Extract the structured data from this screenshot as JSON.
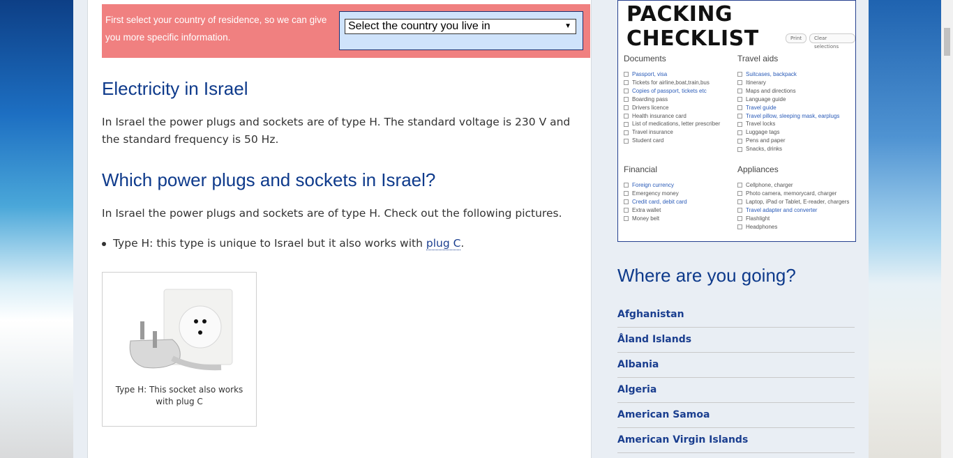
{
  "notice": {
    "text": "First select your country of residence, so we can give you more specific information.",
    "select_value": "Select the country you live in"
  },
  "main": {
    "h_electricity": "Electricity in Israel",
    "p_electricity": "In Israel the power plugs and sockets are of type H. The standard voltage is 230 V and the standard frequency is 50 Hz.",
    "h_which": "Which power plugs and sockets in Israel?",
    "p_which": "In Israel the power plugs and sockets are of type H. Check out the following pictures.",
    "bullet_text": "Type H: this type is unique to Israel but it also works with ",
    "bullet_link": "plug C",
    "bullet_end": ".",
    "figure_caption": "Type H: This socket also works with plug C"
  },
  "checklist": {
    "title": "PACKING CHECKLIST",
    "print": "Print",
    "clear": "Clear selections",
    "documents": {
      "heading": "Documents",
      "items": [
        {
          "label": "Passport, visa",
          "link": true
        },
        {
          "label": "Tickets for airline,boat,train,bus",
          "link": false
        },
        {
          "label": "Copies of passport, tickets etc",
          "link": true
        },
        {
          "label": "Boarding pass",
          "link": false
        },
        {
          "label": "Drivers licence",
          "link": false
        },
        {
          "label": "Health insurance card",
          "link": false
        },
        {
          "label": "List of medications, letter prescriber",
          "link": false
        },
        {
          "label": "Travel insurance",
          "link": false
        },
        {
          "label": "Student card",
          "link": false
        }
      ]
    },
    "travel_aids": {
      "heading": "Travel aids",
      "items": [
        {
          "label": "Suitcases, backpack",
          "link": true
        },
        {
          "label": "Itinerary",
          "link": false
        },
        {
          "label": "Maps and directions",
          "link": false
        },
        {
          "label": "Language guide",
          "link": false
        },
        {
          "label": "Travel guide",
          "link": true
        },
        {
          "label": "Travel pillow, sleeping mask, earplugs",
          "link": true
        },
        {
          "label": "Travel locks",
          "link": false
        },
        {
          "label": "Luggage tags",
          "link": false
        },
        {
          "label": "Pens and paper",
          "link": false
        },
        {
          "label": "Snacks, drinks",
          "link": false
        }
      ]
    },
    "financial": {
      "heading": "Financial",
      "items": [
        {
          "label": "Foreign currency",
          "link": true
        },
        {
          "label": "Emergency money",
          "link": false
        },
        {
          "label": "Credit card, debit card",
          "link": true
        },
        {
          "label": "Extra wallet",
          "link": false
        },
        {
          "label": "Money belt",
          "link": false
        }
      ]
    },
    "appliances": {
      "heading": "Appliances",
      "items": [
        {
          "label": "Cellphone, charger",
          "link": false
        },
        {
          "label": "Photo camera, memorycard, charger",
          "link": false
        },
        {
          "label": "Laptop, iPad or Tablet, E-reader, chargers",
          "link": false
        },
        {
          "label": "Travel adapter and converter",
          "link": true
        },
        {
          "label": "Flashlight",
          "link": false
        },
        {
          "label": "Headphones",
          "link": false
        }
      ]
    }
  },
  "sidebar": {
    "where_title": "Where are you going?",
    "countries": [
      "Afghanistan",
      "Åland Islands",
      "Albania",
      "Algeria",
      "American Samoa",
      "American Virgin Islands"
    ]
  },
  "colors": {
    "heading": "#0e3a8b",
    "notice_bg": "#f08080",
    "link": "#1a3e8f"
  }
}
